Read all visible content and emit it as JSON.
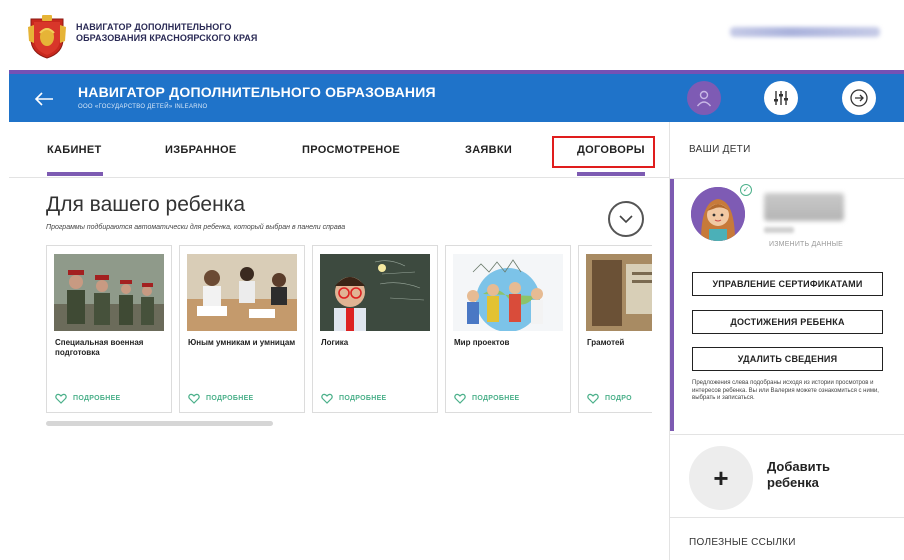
{
  "header": {
    "org_name_line1": "НАВИГАТОР ДОПОЛНИТЕЛЬНОГО",
    "org_name_line2": "ОБРАЗОВАНИЯ КРАСНОЯРСКОГО КРАЯ"
  },
  "navbar": {
    "title": "НАВИГАТОР ДОПОЛНИТЕЛЬНОГО ОБРАЗОВАНИЯ",
    "subtitle": "ООО «ГОСУДАРСТВО ДЕТЕЙ» INLEARNO",
    "accent_color": "#1f73c9",
    "stripe_color": "#7451b4"
  },
  "tabs": [
    {
      "label": "КАБИНЕТ",
      "active": true
    },
    {
      "label": "ИЗБРАННОЕ",
      "active": false
    },
    {
      "label": "ПРОСМОТРЕНОЕ",
      "active": false
    },
    {
      "label": "ЗАЯВКИ",
      "active": false
    },
    {
      "label": "ДОГОВОРЫ",
      "active": false,
      "highlighted": true
    }
  ],
  "recommendations": {
    "title": "Для вашего ребенка",
    "note": "Программы подбираются автоматически для ребенка, который выбран в панели справа",
    "cards": [
      {
        "title": "Специальная военная подготовка",
        "action": "ПОДРОБНЕЕ"
      },
      {
        "title": "Юным умникам и умницам",
        "action": "ПОДРОБНЕЕ"
      },
      {
        "title": "Логика",
        "action": "ПОДРОБНЕЕ"
      },
      {
        "title": "Мир проектов",
        "action": "ПОДРОБНЕЕ"
      },
      {
        "title": "Грамотей",
        "action": "ПОДРО"
      }
    ]
  },
  "sidebar": {
    "heading": "ВАШИ ДЕТИ",
    "edit_link": "ИЗМЕНИТЬ ДАННЫЕ",
    "buttons": [
      "УПРАВЛЕНИЕ СЕРТИФИКАТАМИ",
      "ДОСТИЖЕНИЯ РЕБЕНКА",
      "УДАЛИТЬ СВЕДЕНИЯ"
    ],
    "info": "Предложения слева подобраны исходя из истории просмотров и интересов ребенка. Вы или Валерия можете ознакомиться с ними, выбрать и записаться.",
    "add_child_line1": "Добавить",
    "add_child_line2": "ребенка",
    "links_heading": "ПОЛЕЗНЫЕ ССЫЛКИ"
  }
}
